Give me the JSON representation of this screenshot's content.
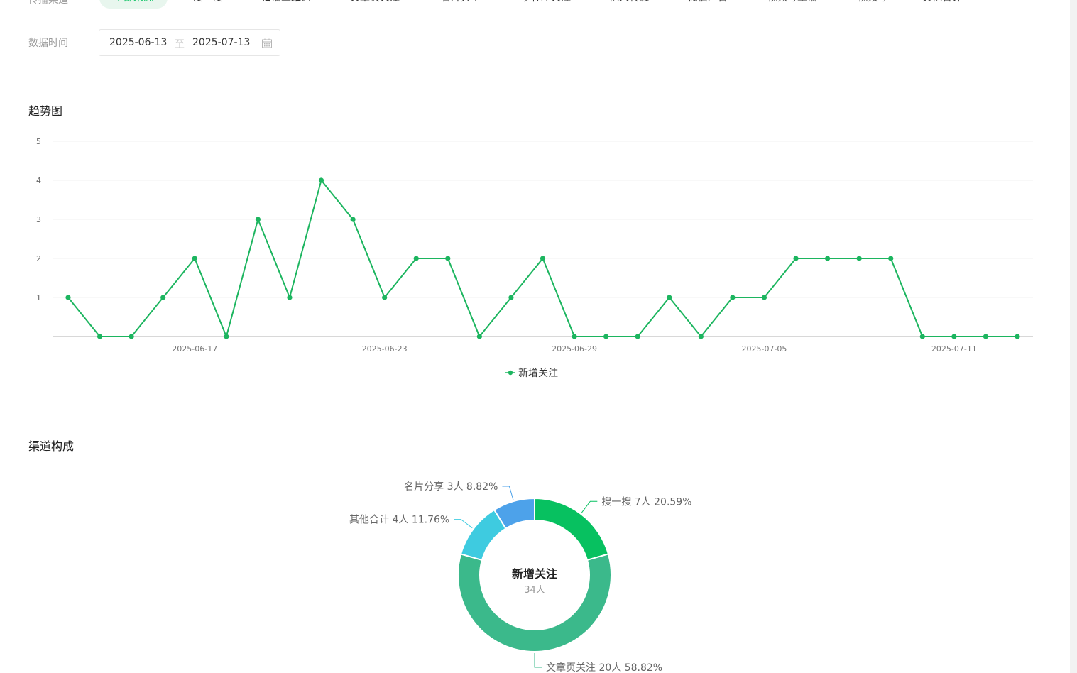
{
  "filters": {
    "label": "传播渠道",
    "chips": [
      "全部来源",
      "搜一搜",
      "扫描二维码",
      "文章页关注",
      "名片分享",
      "小程序关注",
      "他人转载",
      "微信广告",
      "视频号主播",
      "视频号",
      "其他合计"
    ]
  },
  "date": {
    "label": "数据时间",
    "start": "2025-06-13",
    "separator": "至",
    "end": "2025-07-13"
  },
  "trend": {
    "title": "趋势图",
    "legend": "新增关注",
    "color": "#1cb55f"
  },
  "channel": {
    "title": "渠道构成",
    "center_title": "新增关注",
    "center_sub": "34人"
  },
  "chart_data": [
    {
      "type": "line",
      "title": "趋势图",
      "x": [
        "2025-06-13",
        "2025-06-14",
        "2025-06-15",
        "2025-06-16",
        "2025-06-17",
        "2025-06-18",
        "2025-06-19",
        "2025-06-20",
        "2025-06-21",
        "2025-06-22",
        "2025-06-23",
        "2025-06-24",
        "2025-06-25",
        "2025-06-26",
        "2025-06-27",
        "2025-06-28",
        "2025-06-29",
        "2025-06-30",
        "2025-07-01",
        "2025-07-02",
        "2025-07-03",
        "2025-07-04",
        "2025-07-05",
        "2025-07-06",
        "2025-07-07",
        "2025-07-08",
        "2025-07-09",
        "2025-07-10",
        "2025-07-11",
        "2025-07-12",
        "2025-07-13"
      ],
      "series": [
        {
          "name": "新增关注",
          "values": [
            1,
            0,
            0,
            1,
            2,
            0,
            3,
            1,
            4,
            3,
            1,
            2,
            2,
            0,
            1,
            2,
            0,
            0,
            0,
            1,
            0,
            1,
            1,
            2,
            2,
            2,
            2,
            0,
            0,
            0,
            0
          ]
        }
      ],
      "x_tick_labels": [
        "2025-06-17",
        "2025-06-23",
        "2025-06-29",
        "2025-07-05",
        "2025-07-11"
      ],
      "y_ticks": [
        1,
        2,
        3,
        4,
        5
      ],
      "ylim": [
        0,
        5
      ],
      "grid": true,
      "legend_position": "bottom-center"
    },
    {
      "type": "pie",
      "title": "渠道构成",
      "slices": [
        {
          "name": "搜一搜",
          "value": 7,
          "label": "搜一搜 7人 20.59%",
          "color": "#07c160"
        },
        {
          "name": "文章页关注",
          "value": 20,
          "label": "文章页关注 20人 58.82%",
          "color": "#3bb98b"
        },
        {
          "name": "其他合计",
          "value": 4,
          "label": "其他合计 4人 11.76%",
          "color": "#3ecbe0"
        },
        {
          "name": "名片分享",
          "value": 3,
          "label": "名片分享 3人 8.82%",
          "color": "#4da2ea"
        }
      ],
      "total_label": "34人"
    }
  ]
}
